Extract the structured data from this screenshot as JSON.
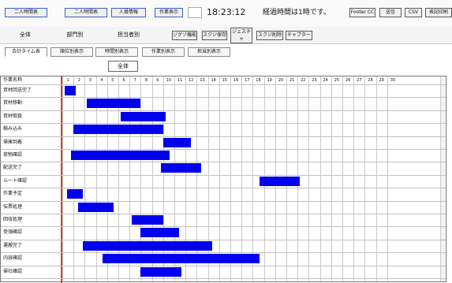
{
  "toolbar": {
    "btn1": "二人時間表",
    "btn2": "二人時間表",
    "btn3": "人員情報",
    "btn4": "作業表示",
    "time": "18:23:12",
    "message": "経過時間は1時です。",
    "btn_right1": "Footer CC",
    "btn_right2": "送信",
    "btn_right3": "CSV",
    "btn_right4": "表記印刷"
  },
  "tabs": [
    "全体",
    "部門別",
    "担当者別"
  ],
  "action_buttons": [
    "ジグゾ機能",
    "スクジ保存",
    "ジェスチャ\n変更",
    "スクジ削除",
    "チャプター"
  ],
  "subtabs": [
    "合計タイム表",
    "順位別表示",
    "時間別表示",
    "作業別表示",
    "担当別表示"
  ],
  "selector": {
    "value": "全体"
  },
  "grid": {
    "header_label": "作業名称",
    "hours": [
      "1",
      "2",
      "3",
      "4",
      "5",
      "6",
      "7",
      "8",
      "9",
      "10",
      "11",
      "12",
      "13",
      "14",
      "15",
      "16",
      "17",
      "18",
      "19",
      "20",
      "21",
      "22",
      "23",
      "24",
      "25",
      "26",
      "27",
      "28",
      "29",
      "30"
    ],
    "rows": [
      {
        "label": "資材回送完了",
        "bars": [
          [
            0.2,
            1.2
          ]
        ]
      },
      {
        "label": "資材移動",
        "bars": [
          [
            2.2,
            7.0
          ]
        ]
      },
      {
        "label": "資材取扱",
        "bars": [
          [
            5.2,
            9.2
          ]
        ]
      },
      {
        "label": "積み込み",
        "bars": [
          [
            1.0,
            9.0
          ]
        ]
      },
      {
        "label": "帰庫到着",
        "bars": [
          [
            9.0,
            11.5
          ]
        ]
      },
      {
        "label": "荷物確認",
        "bars": [
          [
            0.8,
            9.6
          ]
        ]
      },
      {
        "label": "配送完了",
        "bars": [
          [
            8.8,
            12.4
          ]
        ]
      },
      {
        "label": "ルート確認",
        "bars": [
          [
            17.6,
            21.2
          ]
        ]
      },
      {
        "label": "作業予定",
        "bars": [
          [
            0.4,
            1.8
          ]
        ]
      },
      {
        "label": "伝票処理",
        "bars": [
          [
            1.4,
            4.6
          ]
        ]
      },
      {
        "label": "回収処理",
        "bars": [
          [
            6.2,
            9.0
          ]
        ]
      },
      {
        "label": "受領確認",
        "bars": [
          [
            7.0,
            10.4
          ]
        ]
      },
      {
        "label": "運搬完了",
        "bars": [
          [
            1.8,
            13.4
          ]
        ]
      },
      {
        "label": "内容確認",
        "bars": [
          [
            3.6,
            17.6
          ]
        ]
      },
      {
        "label": "帰社確認",
        "bars": [
          [
            7.0,
            10.6
          ]
        ]
      }
    ]
  },
  "colors": {
    "bar": "#0000ee",
    "accent_blue": "#3a5fcd"
  }
}
